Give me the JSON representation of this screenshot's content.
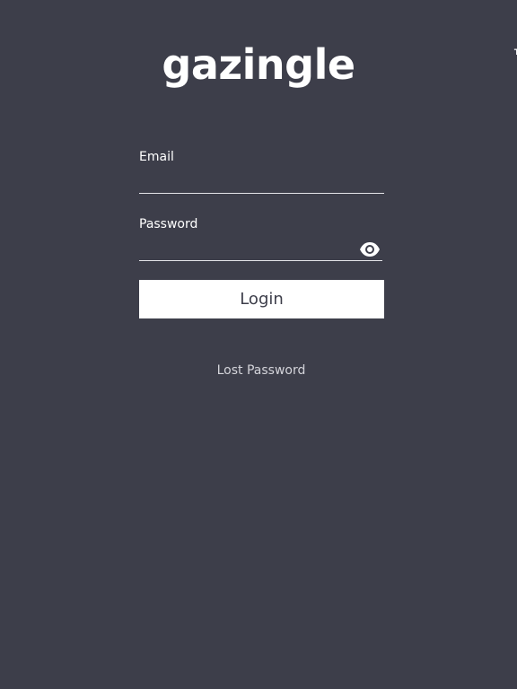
{
  "brand": {
    "name": "gazingle",
    "trademark": "TM"
  },
  "login_form": {
    "email_label": "Email",
    "email_value": "",
    "password_label": "Password",
    "password_value": "",
    "show_password_icon": "eye-icon",
    "login_label": "Login",
    "lost_password_label": "Lost Password"
  },
  "colors": {
    "background": "#3d3e4a",
    "text": "#ffffff",
    "button_background": "#ffffff",
    "button_text": "#3d3e4a"
  }
}
